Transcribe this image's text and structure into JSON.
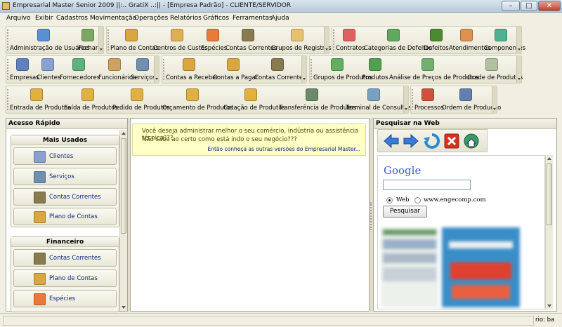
{
  "window": {
    "title": "Empresarial Master Senior 2009 ||:.. GratiX ..:|| - [Empresa Padrão] - CLIENTE/SERVIDOR",
    "minimize": "–",
    "maximize": "□",
    "close": "✕"
  },
  "menu": [
    {
      "label": "Arquivo"
    },
    {
      "label": "Exibir"
    },
    {
      "label": "Cadastros"
    },
    {
      "label": "Movimentação"
    },
    {
      "label": "Operações"
    },
    {
      "label": "Relatórios"
    },
    {
      "label": "Gráficos"
    },
    {
      "label": "Ferramentas"
    },
    {
      "label": "Ajuda"
    }
  ],
  "toolbars": {
    "row1a": [
      "Administração de Usuários",
      "Fechar"
    ],
    "row1b": [
      "Plano de Contas",
      "Centros de Custos",
      "Espécies",
      "Contas Correntes",
      "Grupos de Registros"
    ],
    "row1c": [
      "Contratos",
      "Categorias de Defeitos",
      "Defeitos",
      "Atendimentos",
      "Componentes"
    ],
    "row2a": [
      "Empresas",
      "Clientes",
      "Fornecedores",
      "Funcionários",
      "Serviços"
    ],
    "row2b": [
      "Contas a Receber",
      "Contas a Pagar",
      "Contas Correntes"
    ],
    "row2c": [
      "Grupos de Produtos",
      "Produtos",
      "Análise de Preços de Produtos",
      "Grade de Produtos"
    ],
    "row3a": [
      "Entrada de Produtos",
      "Saída de Produtos",
      "Pedido de Produtos",
      "Orçamento de Produtos",
      "Cotação de Produtos",
      "Transferência de Produtos",
      "Terminal de Consultas"
    ],
    "row3b": [
      "Processos",
      "Ordem de Produção"
    ]
  },
  "quick_access": {
    "title": "Acesso Rápido",
    "groups": [
      {
        "title": "Mais Usados",
        "items": [
          "Clientes",
          "Serviços",
          "Contas Correntes",
          "Plano de Contas"
        ]
      },
      {
        "title": "Financeiro",
        "items": [
          "Contas Correntes",
          "Plano de Contas",
          "Espécies"
        ]
      }
    ]
  },
  "info": {
    "line1": "Você deseja administrar melhor o seu comércio, indústria ou assistência técnica???",
    "line2": "Não sabe ao certo como está indo o seu negócio???",
    "link": "Então conheça as outras versões do Empresarial Master..."
  },
  "web": {
    "title": "Pesquisar na Web",
    "google_logo": "Google",
    "search_value": "",
    "radio_web": "Web",
    "radio_site": "www.engecomp.com",
    "search_button": "Pesquisar"
  },
  "status": {
    "right_text": "rio: ba"
  },
  "colors": {
    "accent": "#0a2a7a",
    "info_bg": "#ffffc6",
    "info_text": "#4a4a00"
  }
}
